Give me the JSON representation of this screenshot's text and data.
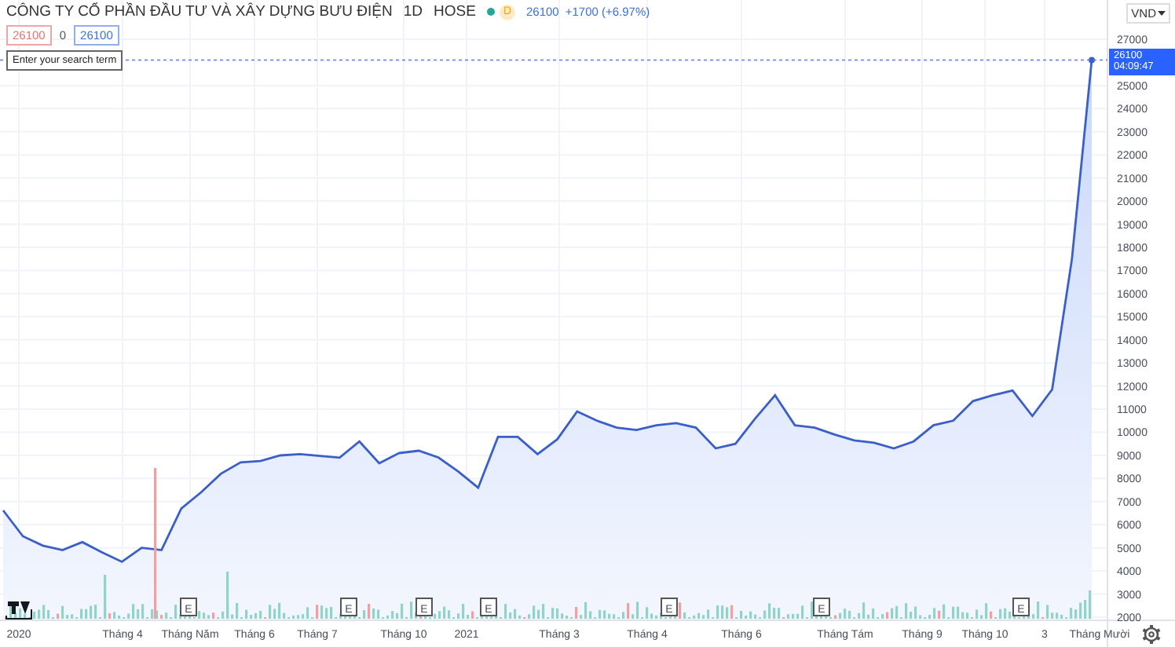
{
  "header": {
    "title": "CÔNG TY CỔ PHẦN ĐẦU TƯ VÀ XÂY DỰNG BƯU ĐIỆN",
    "interval": "1D",
    "exchange": "HOSE",
    "market_open": true,
    "badge": "D",
    "price": "26100",
    "change": "+1700 (+6.97%)"
  },
  "quote": {
    "bid": "26100",
    "spread": "0",
    "ask": "26100"
  },
  "tooltip": "Enter your search term",
  "currency": {
    "label": "VND"
  },
  "last_price": {
    "value": "26100",
    "countdown": "04:09:47"
  },
  "time_axis": [
    "2020",
    "Tháng 4",
    "Tháng Năm",
    "Tháng 6",
    "Tháng 7",
    "Tháng 10",
    "2021",
    "Tháng 3",
    "Tháng 4",
    "Tháng 6",
    "Tháng Tám",
    "Tháng 9",
    "Tháng 10",
    "3",
    "Tháng Mười"
  ],
  "earnings_markers": [
    "E",
    "E",
    "E",
    "E",
    "E",
    "E",
    "E"
  ],
  "chart_data": {
    "type": "area",
    "grid": true,
    "series": [
      {
        "color": "#3b5fc9",
        "values": [
          6620,
          5500,
          5100,
          4900,
          5250,
          4800,
          4400,
          5000,
          4900,
          6700,
          7400,
          8200,
          8700,
          8750,
          9000,
          9050,
          8980,
          8900,
          9600,
          8660,
          9100,
          9200,
          8900,
          8300,
          7600,
          9800,
          9800,
          9050,
          9700,
          10900,
          10500,
          10200,
          10100,
          10300,
          10400,
          10200,
          9300,
          9500,
          10600,
          11600,
          10300,
          10200,
          9900,
          9650,
          9550,
          9300,
          9600,
          10300,
          10500,
          11350,
          11600,
          11800,
          10700,
          11850,
          17500,
          26100
        ]
      }
    ],
    "ylim": [
      2000,
      27000
    ],
    "yticks": [
      2000,
      3000,
      4000,
      5000,
      6000,
      7000,
      8000,
      9000,
      10000,
      11000,
      12000,
      13000,
      14000,
      15000,
      16000,
      17000,
      18000,
      19000,
      20000,
      21000,
      22000,
      23000,
      24000,
      25000,
      27000
    ]
  }
}
